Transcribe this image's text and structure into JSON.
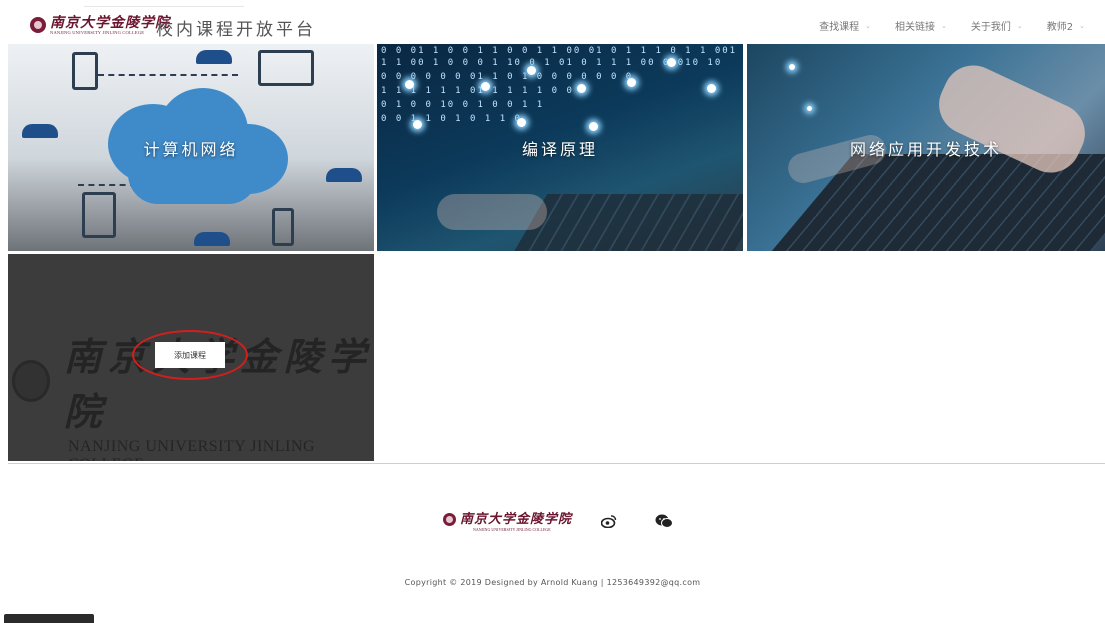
{
  "header": {
    "logo_cn": "南京大学金陵学院",
    "logo_en": "NANJING UNIVERSITY JINLING COLLEGE",
    "platform_title": "校内课程开放平台",
    "nav": [
      {
        "label": "查找课程",
        "icon": "chevron-down-icon"
      },
      {
        "label": "相关链接",
        "icon": "chevron-down-icon"
      },
      {
        "label": "关于我们",
        "icon": "chevron-down-icon"
      },
      {
        "label": "教师2",
        "icon": "chevron-down-icon"
      }
    ]
  },
  "courses": [
    {
      "title": "计算机网络"
    },
    {
      "title": "编译原理"
    },
    {
      "title": "网络应用开发技术"
    }
  ],
  "add_tile": {
    "watermark_cn": "南京大学金陵学院",
    "watermark_en": "NANJING UNIVERSITY JINLING COLLEGE",
    "button_label": "添加课程"
  },
  "footer": {
    "logo_cn": "南京大学金陵学院",
    "logo_en": "NANJING UNIVERSITY JINLING COLLEGE",
    "weibo_icon": "weibo-icon",
    "wechat_icon": "wechat-icon",
    "copyright": "Copyright © 2019 Designed by Arnold Kuang | 1253649392@qq.com"
  },
  "colors": {
    "brand": "#6b1630",
    "annotation": "#d0201c"
  }
}
